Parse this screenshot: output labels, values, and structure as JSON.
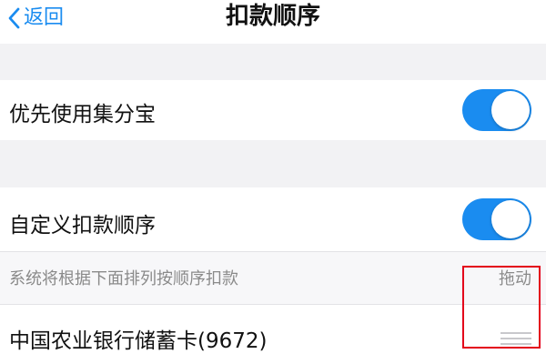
{
  "header": {
    "back_label": "返回",
    "title": "扣款顺序"
  },
  "settings": {
    "prefer_jifenbao": {
      "label": "优先使用集分宝",
      "enabled": true
    },
    "custom_order": {
      "label": "自定义扣款顺序",
      "enabled": true
    }
  },
  "order_hint": {
    "text": "系统将根据下面排列按顺序扣款",
    "drag_label": "拖动"
  },
  "payment_methods": [
    {
      "name": "中国农业银行储蓄卡(9672)"
    }
  ],
  "colors": {
    "accent": "#1a8cf0",
    "highlight": "#e3001b"
  }
}
